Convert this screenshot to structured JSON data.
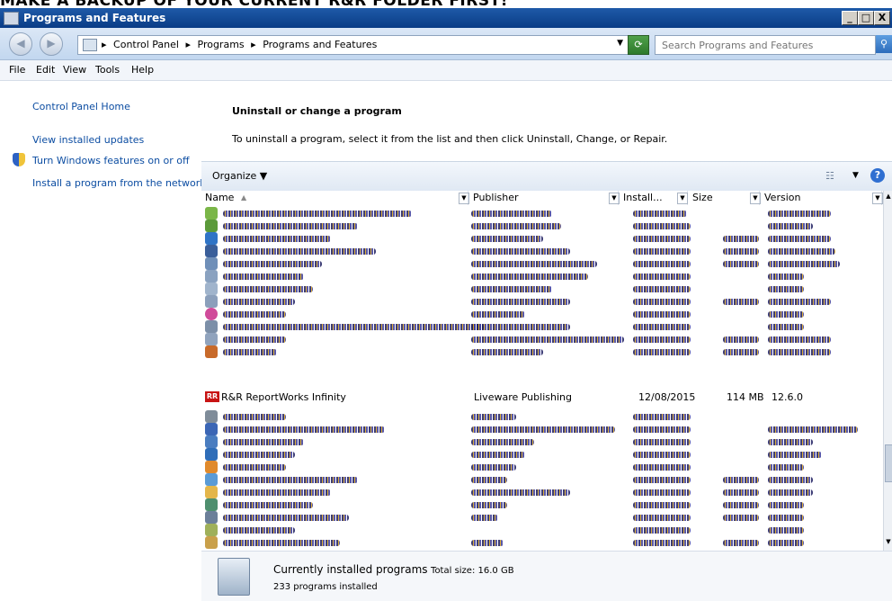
{
  "page_heading": "MAKE A BACKUP OF YOUR CURRENT R&R FOLDER FIRST!",
  "window": {
    "title": "Programs and Features",
    "minimize_label": "_",
    "maximize_label": "□",
    "close_label": "X"
  },
  "address": {
    "crumbs": [
      "Control Panel",
      "Programs",
      "Programs and Features"
    ],
    "search_placeholder": "Search Programs and Features"
  },
  "menu": {
    "items": [
      {
        "label": "File"
      },
      {
        "label": "Edit"
      },
      {
        "label": "View"
      },
      {
        "label": "Tools"
      },
      {
        "label": "Help"
      }
    ]
  },
  "sidebar": {
    "links": [
      {
        "label": "Control Panel Home"
      },
      {
        "label": "View installed updates"
      },
      {
        "label": "Turn Windows features on or off"
      },
      {
        "label": "Install a program from the network"
      }
    ]
  },
  "main": {
    "title": "Uninstall or change a program",
    "description": "To uninstall a program, select it from the list and then click Uninstall, Change, or Repair."
  },
  "toolbar": {
    "organize_label": "Organize"
  },
  "columns": [
    {
      "label": "Name"
    },
    {
      "label": "Publisher"
    },
    {
      "label": "Install..."
    },
    {
      "label": "Size"
    },
    {
      "label": "Version"
    }
  ],
  "highlighted_program": {
    "name": "R&R ReportWorks Infinity",
    "publisher": "Liveware Publishing",
    "installed_on": "12/08/2015",
    "size": "114 MB",
    "version": "12.6.0",
    "icon_text": "RR"
  },
  "details": {
    "currently_installed_label": "Currently installed programs",
    "total_size_label": "Total size: 16.0 GB",
    "count_label": "233 programs installed"
  },
  "colors": {
    "link": "#0c4da2",
    "titlebar": "#0a3c86"
  }
}
